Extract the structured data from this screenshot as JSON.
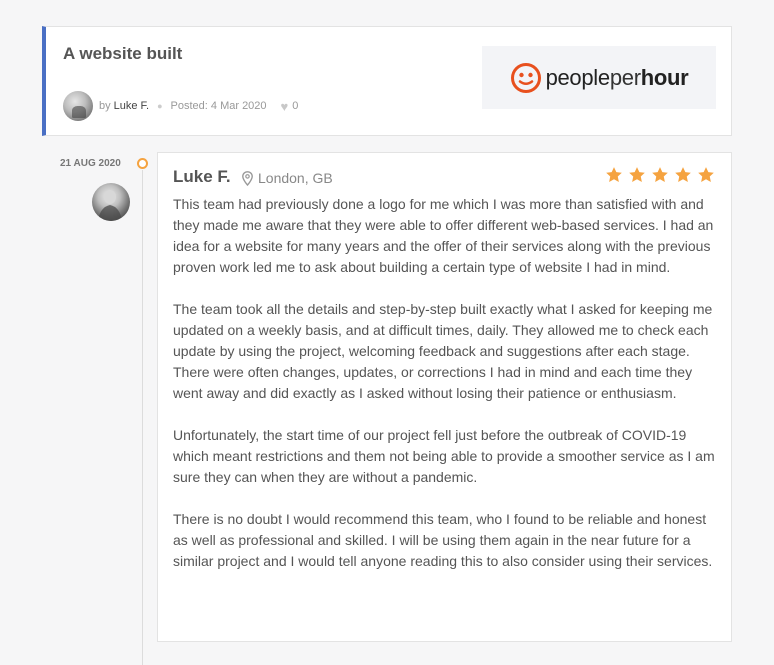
{
  "header": {
    "title": "A website built",
    "by_label": "by",
    "author": "Luke F.",
    "posted": "Posted: 4 Mar 2020",
    "likes": "0",
    "logo": {
      "people": "people",
      "per": "per",
      "hour": "hour",
      "brand_color": "#e8501e"
    },
    "accent_color": "#4a6fc4"
  },
  "timeline": {
    "date": "21 AUG 2020",
    "dot_color": "#f5a340"
  },
  "review": {
    "name": "Luke F.",
    "location": "London, GB",
    "rating": 5,
    "star_color": "#f5a340",
    "paragraphs": [
      "This team had previously done a logo for me which I was more than satisfied with and they made me aware that they were able to offer different web-based services. I had an idea for a website for many years and the offer of their services along with the previous proven work led me to ask about building a certain type of website I had in mind.",
      "The team took all the details and step-by-step built exactly what I asked for keeping me updated on a weekly basis, and at difficult times, daily. They allowed me to check each update by using the project, welcoming feedback and suggestions after each stage. There were often changes, updates,  or corrections I had in mind and each time they went away and did exactly as I asked without losing their patience or enthusiasm.",
      "Unfortunately, the start time of our project fell just before the outbreak of COVID-19 which meant restrictions and them not being able to provide a smoother service as I am sure they can when they are without a pandemic.",
      "There is no doubt I would recommend this team, who I found to be reliable and honest as well as professional and skilled. I will be using them again in the near future for a similar project and I would tell anyone reading this to also consider using their services."
    ]
  }
}
